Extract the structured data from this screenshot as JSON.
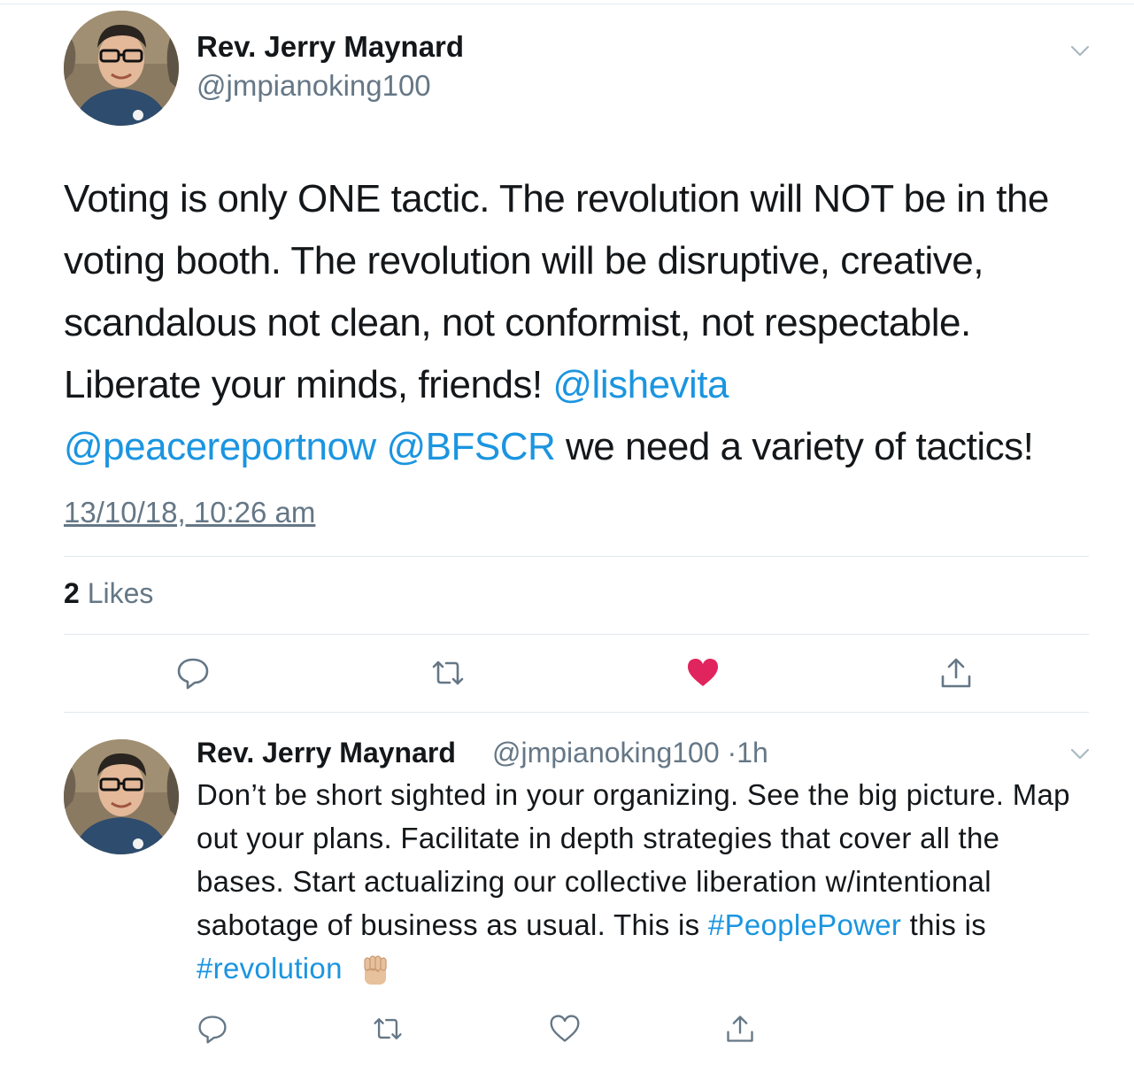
{
  "main_tweet": {
    "author_name": "Rev. Jerry Maynard",
    "author_handle": "@jmpianoking100",
    "text_parts": [
      "Voting is only ONE tactic. The revolution will NOT be in the voting booth. The revolution will be disruptive, creative, scandalous not clean, not conformist, not respectable. Liberate your minds, friends! ",
      "@lishevita",
      "@peacereportnow",
      "@BFSCR",
      " we need a variety of tactics!"
    ],
    "timestamp": "13/10/18, 10:26 am",
    "likes_count": "2",
    "likes_label": "Likes"
  },
  "reply_tweet": {
    "author_name": "Rev. Jerry Maynard",
    "author_handle": "@jmpianoking100",
    "separator": "·",
    "age": "1h",
    "text_parts": [
      "Don’t be short sighted in your organizing. See the big picture. Map out your plans. Facilitate in depth strategies that cover all the bases. Start actualizing our collective liberation w/intentional sabotage of business as usual. This is ",
      "#PeoplePower",
      " this is ",
      "#revolution"
    ],
    "emoji": "raised-fist-medium-light-skin-tone"
  },
  "colors": {
    "link": "#1b95e0",
    "liked": "#e0245e",
    "icon": "#657786",
    "text": "#14171a",
    "divider": "#e1e8ed"
  },
  "icons": {
    "reply": "speech-bubble-icon",
    "retweet": "retweet-arrows-icon",
    "like": "heart-icon",
    "share": "share-arrow-icon",
    "menu": "chevron-down-icon"
  }
}
